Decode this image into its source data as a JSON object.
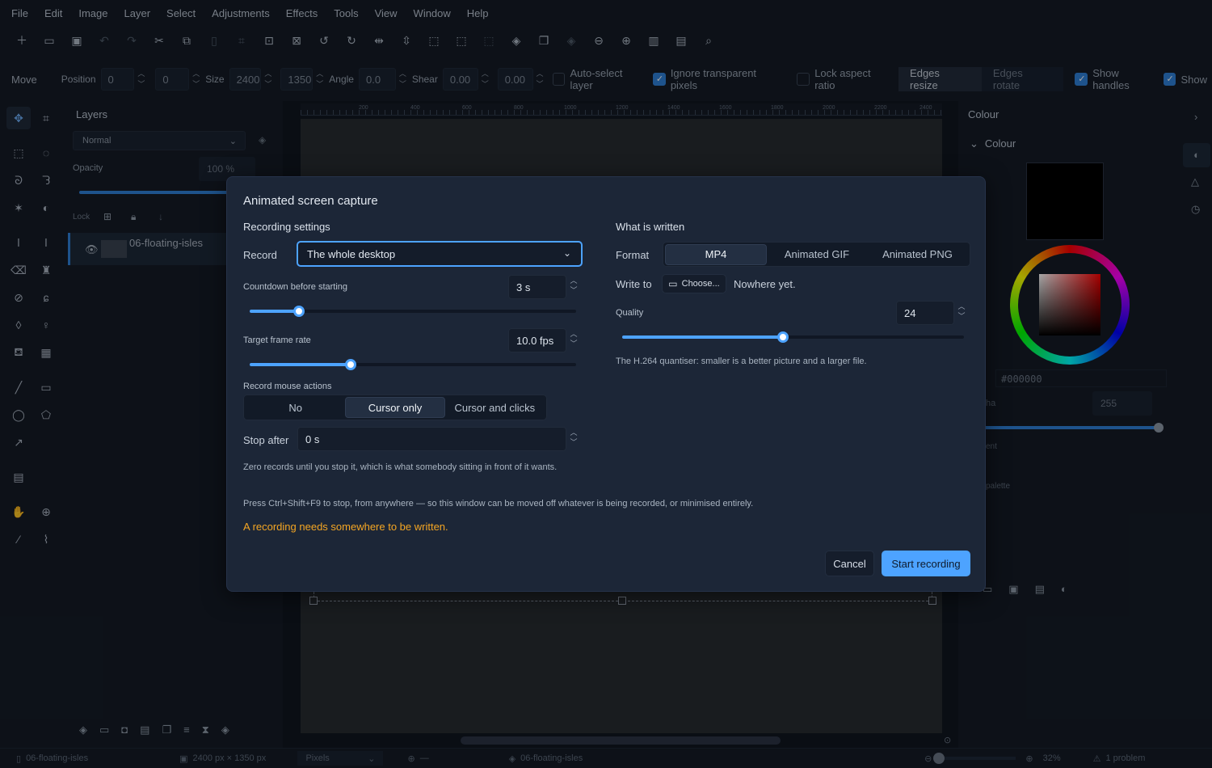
{
  "menu": [
    "File",
    "Edit",
    "Image",
    "Layer",
    "Select",
    "Adjustments",
    "Effects",
    "Tools",
    "View",
    "Window",
    "Help"
  ],
  "options": {
    "tool": "Move",
    "position_label": "Position",
    "pos_x": "0",
    "pos_y": "0",
    "size_label": "Size",
    "size_w": "2400",
    "size_h": "1350",
    "angle_label": "Angle",
    "angle": "0.0",
    "shear_label": "Shear",
    "shear_x": "0.00",
    "shear_y": "0.00",
    "auto_select": "Auto-select layer",
    "ignore_transparent": "Ignore transparent pixels",
    "lock_aspect": "Lock aspect ratio",
    "edges_resize": "Edges resize",
    "edges_rotate": "Edges rotate",
    "show_handles": "Show handles",
    "show_more": "Show"
  },
  "layers": {
    "title": "Layers",
    "blend": "Normal",
    "opacity_label": "Opacity",
    "opacity": "100 %",
    "lock_label": "Lock",
    "layer_name": "06-floating-isles"
  },
  "ruler_ticks": [
    "200",
    "400",
    "600",
    "800",
    "1000",
    "1200",
    "1400",
    "1600",
    "1800",
    "2000",
    "2200",
    "2400"
  ],
  "colour": {
    "panel_title": "Colour",
    "section": "Colour",
    "hex": "#000000",
    "alpha_label": "ha",
    "alpha": "255",
    "gradient_label": "ent",
    "palette_label": "palette"
  },
  "status": {
    "doc": "06-floating-isles",
    "dims": "2400 px × 1350 px",
    "units": "Pixels",
    "cursor": "—",
    "layer": "06-floating-isles",
    "zoom": "32%",
    "problems": "1 problem"
  },
  "dialog": {
    "title": "Animated screen capture",
    "left_title": "Recording settings",
    "record_label": "Record",
    "record_value": "The whole desktop",
    "countdown_label": "Countdown before starting",
    "countdown_value": "3  s",
    "countdown_fraction": 0.15,
    "framerate_label": "Target frame rate",
    "framerate_value": "10.0  fps",
    "framerate_fraction": 0.31,
    "mouse_label": "Record mouse actions",
    "mouse_options": [
      "No",
      "Cursor only",
      "Cursor and clicks"
    ],
    "mouse_selected": 1,
    "stop_label": "Stop after",
    "stop_value": "0  s",
    "stop_hint": "Zero records until you stop it, which is what somebody sitting in front of it wants.",
    "right_title": "What is written",
    "format_label": "Format",
    "format_options": [
      "MP4",
      "Animated GIF",
      "Animated PNG"
    ],
    "format_selected": 0,
    "write_label": "Write to",
    "choose_label": "Choose...",
    "write_value": "Nowhere yet.",
    "quality_label": "Quality",
    "quality_value": "24",
    "quality_fraction": 0.47,
    "quality_hint": "The H.264 quantiser: smaller is a better picture and a larger file.",
    "shortcut_hint": "Press Ctrl+Shift+F9 to stop, from anywhere — so this window can be moved off whatever is being recorded, or minimised entirely.",
    "warning": "A recording needs somewhere to be written.",
    "cancel": "Cancel",
    "start": "Start recording"
  }
}
